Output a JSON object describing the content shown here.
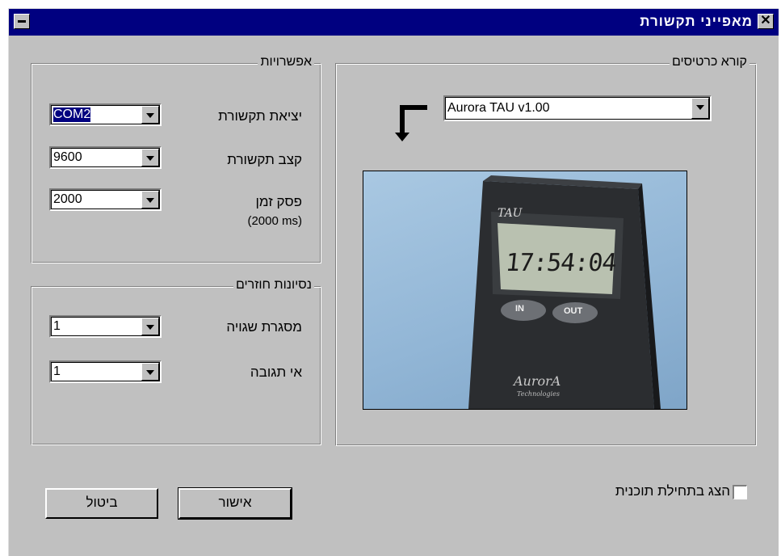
{
  "window": {
    "title": "מאפייני תקשורת",
    "close_glyph": "✕"
  },
  "options_group": {
    "legend": "אפשרויות",
    "port": {
      "label": "יציאת תקשורת",
      "value": "COM2"
    },
    "baud": {
      "label": "קצב תקשורת",
      "value": "9600"
    },
    "timeout": {
      "label": "פסק זמן",
      "sublabel": "(2000 ms)",
      "value": "2000"
    }
  },
  "retries_group": {
    "legend": "נסיונות חוזרים",
    "error_limit": {
      "label": "מסגרת שגויה",
      "value": "1"
    },
    "no_response": {
      "label": "אי תגובה",
      "value": "1"
    }
  },
  "card_reader_group": {
    "legend": "קורא כרטיסים",
    "reader_select": {
      "value": "Aurora TAU v1.00"
    },
    "device": {
      "brand": "TAU",
      "time": "17:54:04",
      "in_button": "IN",
      "out_button": "OUT",
      "logo": "AurorA",
      "logo_sub": "Technologies"
    }
  },
  "footer": {
    "show_on_startup_label": "הצג בתחילת תוכנית",
    "ok_label": "אישור",
    "cancel_label": "ביטול"
  }
}
